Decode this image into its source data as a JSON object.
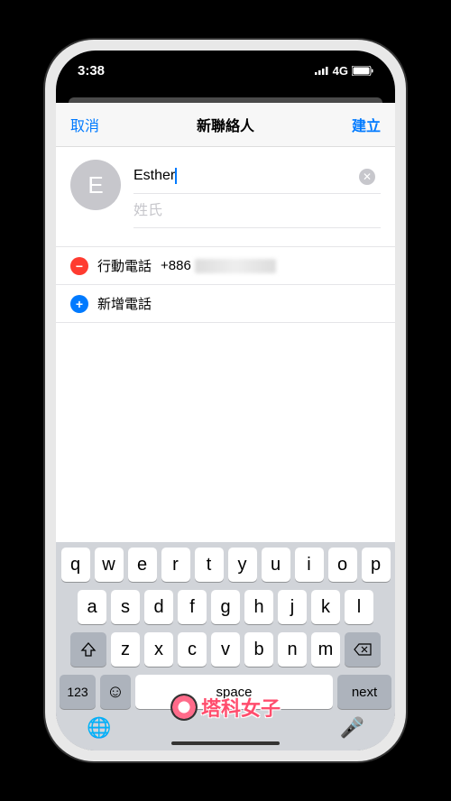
{
  "status": {
    "time": "3:38",
    "network": "4G"
  },
  "header": {
    "cancel": "取消",
    "title": "新聯絡人",
    "done": "建立"
  },
  "contact": {
    "avatarLetter": "E",
    "firstName": "Esther",
    "lastNamePlaceholder": "姓氏"
  },
  "phones": {
    "mobileLabel": "行動電話",
    "mobileValue": "+886",
    "addLabel": "新增電話"
  },
  "keyboard": {
    "row1": [
      "q",
      "w",
      "e",
      "r",
      "t",
      "y",
      "u",
      "i",
      "o",
      "p"
    ],
    "row2": [
      "a",
      "s",
      "d",
      "f",
      "g",
      "h",
      "j",
      "k",
      "l"
    ],
    "row3": [
      "z",
      "x",
      "c",
      "v",
      "b",
      "n",
      "m"
    ],
    "numKey": "123",
    "space": "space",
    "next": "next"
  },
  "watermark": "塔科女子"
}
